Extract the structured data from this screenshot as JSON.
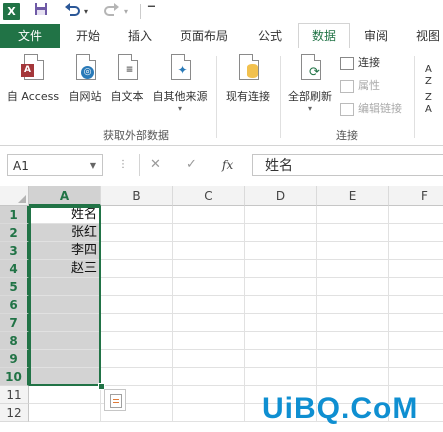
{
  "quick_access": {
    "app_icon": "excel-icon",
    "app_letter": "X",
    "items": [
      "save-icon",
      "undo-icon",
      "undo-dropdown-icon",
      "redo-icon",
      "redo-dropdown-icon",
      "customize-icon"
    ]
  },
  "tabs": [
    {
      "label": "文件",
      "active": false
    },
    {
      "label": "开始",
      "active": false
    },
    {
      "label": "插入",
      "active": false
    },
    {
      "label": "页面布局",
      "active": false
    },
    {
      "label": "公式",
      "active": false
    },
    {
      "label": "数据",
      "active": true
    },
    {
      "label": "审阅",
      "active": false
    },
    {
      "label": "视图",
      "active": false
    }
  ],
  "ribbon": {
    "get_external": {
      "group_label": "获取外部数据",
      "buttons": [
        {
          "label": "自 Access",
          "icon": "access-db-icon",
          "badge": "A",
          "color": "#a4373a"
        },
        {
          "label": "自网站",
          "icon": "web-icon",
          "badge": "◎",
          "color": "#2a7ab8"
        },
        {
          "label": "自文本",
          "icon": "text-file-icon",
          "badge": "≡",
          "color": "#555555"
        },
        {
          "label": "自其他来源",
          "icon": "other-sources-icon",
          "badge": "✦",
          "color": "#2a7ab8"
        }
      ]
    },
    "existing": {
      "label": "现有连接",
      "icon": "existing-connections-icon"
    },
    "connections": {
      "group_label": "连接",
      "refresh_label": "全部刷新",
      "connections_label": "连接",
      "properties_label": "属性",
      "edit_links_label": "编辑链接"
    },
    "sort_labels": [
      "A",
      "Z",
      "Z",
      "A"
    ]
  },
  "formula_bar": {
    "name_box": "A1",
    "fx_label": "fx",
    "cancel_label": "✕",
    "enter_label": "✓",
    "content": "姓名"
  },
  "grid": {
    "columns": [
      "A",
      "B",
      "C",
      "D",
      "E",
      "F"
    ],
    "selected_column": "A",
    "rows": [
      "1",
      "2",
      "3",
      "4",
      "5",
      "6",
      "7",
      "8",
      "9",
      "10",
      "11",
      "12"
    ],
    "cells_a": [
      "姓名",
      "张红",
      "李四",
      "赵三",
      "",
      "",
      "",
      "",
      "",
      "",
      "",
      ""
    ]
  },
  "watermark": "UiBQ.CoM",
  "colors": {
    "accent": "#217346",
    "selection_fill": "#d3d3d3"
  }
}
